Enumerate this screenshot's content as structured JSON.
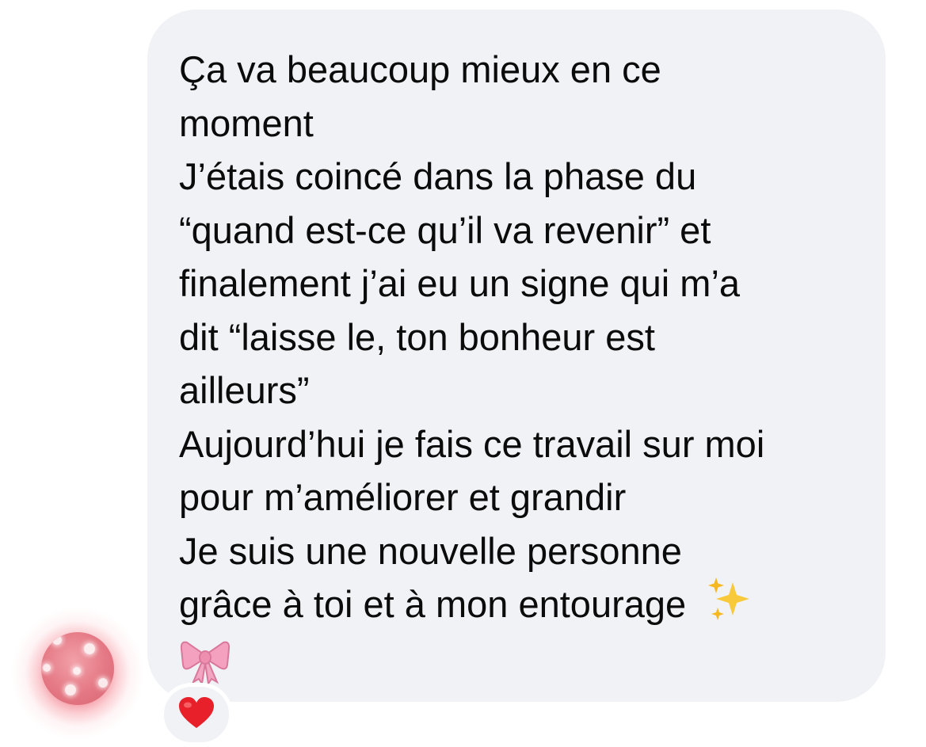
{
  "message": {
    "lines": [
      "Ça va beaucoup mieux en ce",
      "moment",
      "J’étais coincé dans la phase du",
      "“quand est-ce qu’il va revenir” et",
      "finalement j’ai eu un signe qui m’a",
      "dit “laisse le, ton bonheur est",
      "ailleurs”",
      "Aujourd’hui je fais ce travail sur moi",
      "pour m’améliorer et grandir",
      "Je suis une nouvelle personne",
      "grâce à toi et à mon entourage"
    ],
    "trailing_emojis": [
      "sparkles-emoji",
      "ribbon-emoji"
    ]
  },
  "reaction": {
    "emoji": "red-heart-emoji"
  },
  "colors": {
    "page_background": "#ffffff",
    "bubble_background": "#f1f2f6",
    "text": "#0b0b0b",
    "heart": "#e8202a",
    "ribbon": "#f4a1bf",
    "sparkles": "#f8c93a",
    "avatar_glow": "#e85060"
  }
}
